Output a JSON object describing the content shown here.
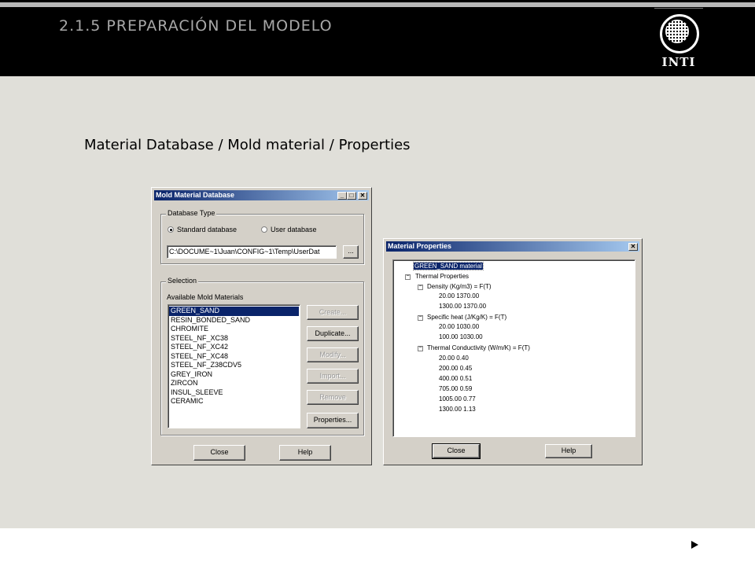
{
  "slide": {
    "title": "2.1.5 PREPARACIÓN DEL MODELO",
    "logo_text": "INTI",
    "subtitle": "Material Database / Mold material / Properties"
  },
  "mold_db": {
    "title": "Mold Material Database",
    "db_type_label": "Database Type",
    "standard_label": "Standard database",
    "user_label": "User database",
    "selected_type": "standard",
    "path_value": "C:\\DOCUME~1\\Juan\\CONFIG~1\\Temp\\UserDat",
    "browse_label": "...",
    "selection_label": "Selection",
    "available_label": "Available Mold Materials",
    "materials": [
      "GREEN_SAND",
      "RESIN_BONDED_SAND",
      "CHROMITE",
      "STEEL_NF_XC38",
      "STEEL_NF_XC42",
      "STEEL_NF_XC48",
      "STEEL_NF_Z38CDV5",
      "GREY_IRON",
      "ZIRCON",
      "INSUL_SLEEVE",
      "CERAMIC"
    ],
    "selected_material": "GREEN_SAND",
    "create_label": "Create...",
    "duplicate_label": "Duplicate...",
    "modify_label": "Modify...",
    "import_label": "Import...",
    "remove_label": "Remove",
    "properties_label": "Properties...",
    "close_label": "Close",
    "help_label": "Help"
  },
  "mat_props": {
    "title": "Material Properties",
    "root": "GREEN_SAND material",
    "thermal_label": "Thermal Properties",
    "density_label": "Density (Kg/m3) = F(T)",
    "density_rows": [
      "20.00  1370.00",
      "1300.00  1370.00"
    ],
    "specific_heat_label": "Specific heat (J/Kg/K) = F(T)",
    "specific_heat_rows": [
      "20.00  1030.00",
      "100.00  1030.00"
    ],
    "conductivity_label": "Thermal Conductivity (W/m/K) = F(T)",
    "conductivity_rows": [
      "20.00  0.40",
      "200.00  0.45",
      "400.00  0.51",
      "705.00  0.59",
      "1005.00  0.77",
      "1300.00  1.13"
    ],
    "close_label": "Close",
    "help_label": "Help"
  }
}
